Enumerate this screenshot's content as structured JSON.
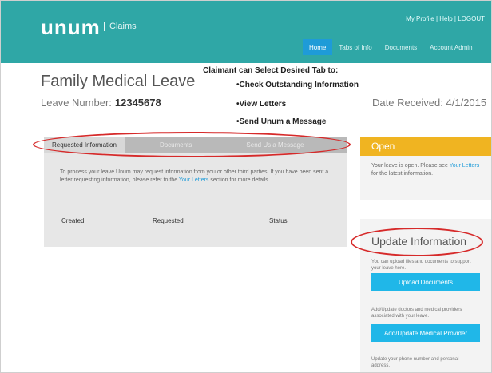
{
  "header": {
    "logo_text": "unum",
    "product": "Claims",
    "top_links": "My Profile | Help | LOGOUT",
    "tabs": [
      {
        "label": "Home",
        "active": true
      },
      {
        "label": "Tabs of Info",
        "active": false
      },
      {
        "label": "Documents",
        "active": false
      },
      {
        "label": "Account Admin",
        "active": false
      }
    ]
  },
  "page": {
    "title": "Family Medical Leave",
    "leave_number_label": "Leave Number:",
    "leave_number": "12345678",
    "date_received_label": "Date Received:",
    "date_received": "4/1/2015"
  },
  "annotation": {
    "heading": "Claimant can Select Desired Tab to:",
    "items": [
      "•Check Outstanding Information",
      "•View Letters",
      "•Send Unum a Message"
    ]
  },
  "inner_tabs": [
    {
      "label": "Requested Information",
      "active": true
    },
    {
      "label": "Documents",
      "active": false
    },
    {
      "label": "Send Us a Message",
      "active": false
    }
  ],
  "requested_info": {
    "text_before_link": "To process your leave Unum may request information from you or other third parties. If you have been sent a letter requesting information, please refer to the",
    "link": "Your Letters",
    "text_after_link": "section for more details.",
    "columns": [
      "Created",
      "Requested",
      "Status"
    ]
  },
  "open_box": {
    "title": "Open",
    "text_before_link": "Your leave is open. Please see",
    "link": "Your Letters",
    "text_after_link": "for the latest information."
  },
  "update_box": {
    "title": "Update Information",
    "upload_help": "You can upload files and documents to support your leave here.",
    "upload_button": "Upload Documents",
    "provider_help": "Add/Update doctors and medical providers associated with your leave.",
    "provider_button": "Add/Update Medical Provider",
    "footer_help": "Update your phone number and personal address."
  },
  "colors": {
    "teal": "#2fa7a6",
    "blue_button": "#20b7e8",
    "orange": "#f0b421",
    "annotation_red": "#d62a2a"
  }
}
